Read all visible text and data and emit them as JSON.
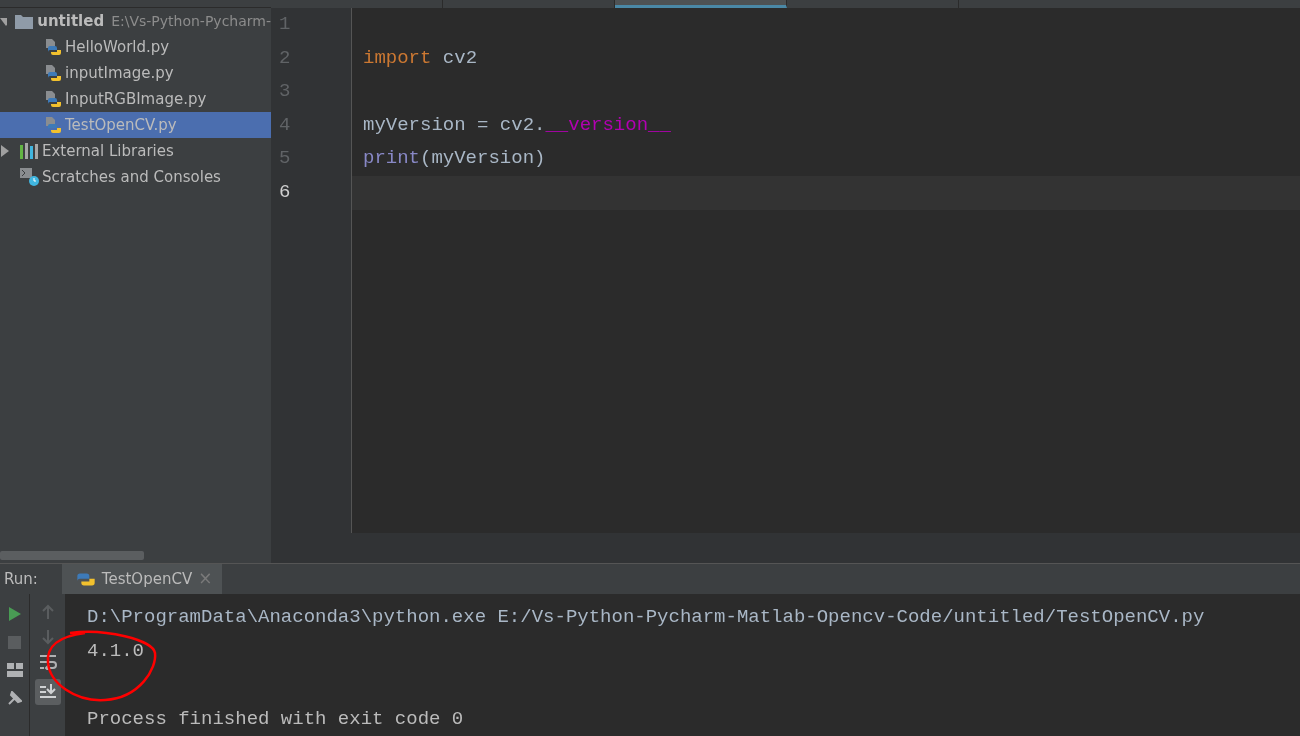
{
  "editor_tabs": [
    {
      "selected": false
    },
    {
      "selected": false
    },
    {
      "selected": true
    },
    {
      "selected": false
    }
  ],
  "project_tree": [
    {
      "label": "untitled",
      "path": "E:\\Vs-Python-Pycharm-",
      "kind": "folder",
      "expanded": true,
      "selected": false,
      "children": [
        {
          "label": "HelloWorld.py",
          "kind": "python",
          "selected": false
        },
        {
          "label": "inputImage.py",
          "kind": "python",
          "selected": false
        },
        {
          "label": "InputRGBImage.py",
          "kind": "python",
          "selected": false
        },
        {
          "label": "TestOpenCV.py",
          "kind": "python",
          "selected": true
        }
      ]
    },
    {
      "label": "External Libraries",
      "kind": "library",
      "expanded": false,
      "selected": false
    },
    {
      "label": "Scratches and Consoles",
      "kind": "scratch",
      "selected": false
    }
  ],
  "editor": {
    "lines": [
      {
        "number": "1",
        "current": false
      },
      {
        "number": "2",
        "current": false,
        "tokens": [
          {
            "text": "import",
            "kind": "keyword"
          },
          {
            "text": " cv2",
            "kind": "plain"
          }
        ]
      },
      {
        "number": "3",
        "current": false
      },
      {
        "number": "4",
        "current": false,
        "tokens": [
          {
            "text": "myVersion = cv2.",
            "kind": "plain"
          },
          {
            "text": "__version__",
            "kind": "magic"
          }
        ]
      },
      {
        "number": "5",
        "current": false,
        "tokens": [
          {
            "text": "print",
            "kind": "builtin"
          },
          {
            "text": "(myVersion)",
            "kind": "plain"
          }
        ]
      },
      {
        "number": "6",
        "current": true
      }
    ]
  },
  "run_panel": {
    "label": "Run:",
    "tabs": [
      {
        "label": "TestOpenCV",
        "close": "×",
        "selected": true
      }
    ],
    "output": [
      {
        "text": "D:\\ProgramData\\Anaconda3\\python.exe E:/Vs-Python-Pycharm-Matlab-Opencv-Code/untitled/TestOpenCV.py",
        "kind": "command"
      },
      {
        "text": "4.1.0",
        "kind": "result"
      },
      {
        "text": "Process finished with exit code 0",
        "kind": "status"
      }
    ]
  }
}
